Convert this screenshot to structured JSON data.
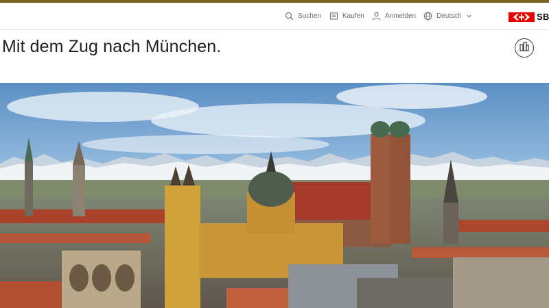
{
  "nav": {
    "search_label": "Suchen",
    "buy_label": "Kaufen",
    "login_label": "Anmelden",
    "language_label": "Deutsch",
    "logo_text": "SBB"
  },
  "page": {
    "title": "Mit dem Zug nach München."
  },
  "icons": {
    "search": "search-icon",
    "cart": "cart-icon",
    "user": "user-icon",
    "globe": "globe-icon",
    "chevron": "chevron-down-icon",
    "logo": "sbb-logo-icon",
    "info": "city-info-icon"
  },
  "colors": {
    "accent_bar": "#7a6420",
    "brand_red": "#eb0000",
    "nav_text": "#6b6b6b"
  }
}
